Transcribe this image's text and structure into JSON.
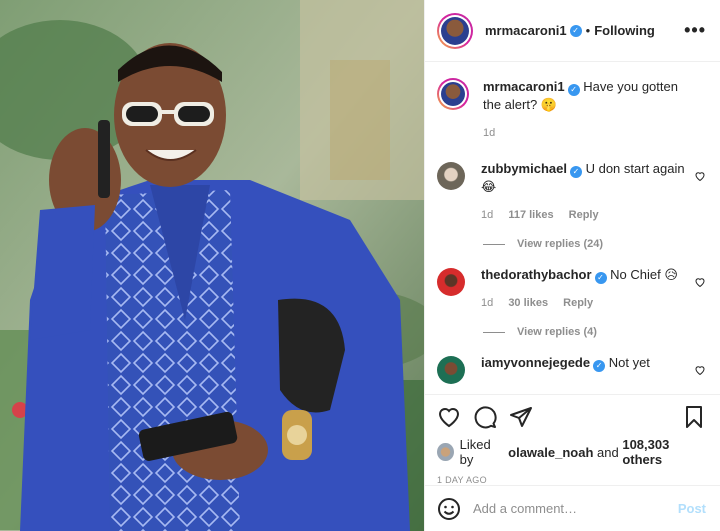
{
  "header": {
    "username": "mrmacaroni1",
    "separator": "•",
    "follow_status": "Following",
    "more_label": "•••"
  },
  "caption": {
    "username": "mrmacaroni1",
    "text": "Have you gotten the alert? 🤫",
    "time": "1d"
  },
  "comments": [
    {
      "username": "zubbymichael",
      "verified": true,
      "text": "U don start again 😂",
      "time": "1d",
      "likes": "117 likes",
      "reply": "Reply",
      "view_replies": "View replies (24)"
    },
    {
      "username": "thedorathybachor",
      "verified": true,
      "text": "No Chief 😥",
      "time": "1d",
      "likes": "30 likes",
      "reply": "Reply",
      "view_replies": "View replies (4)"
    },
    {
      "username": "iamyvonnejegede",
      "verified": true,
      "text": "Not yet"
    }
  ],
  "likes_line": {
    "prefix": "Liked by",
    "user": "olawale_noah",
    "conj": "and",
    "count": "108,303 others"
  },
  "post_age": "1 DAY AGO",
  "comment_box": {
    "placeholder": "Add a comment…",
    "post_label": "Post"
  },
  "icons": {
    "like": "heart-icon",
    "comment": "comment-icon",
    "share": "share-icon",
    "save": "bookmark-icon",
    "emoji": "emoji-icon",
    "verified": "verified-badge-icon",
    "more": "more-options-icon"
  },
  "colors": {
    "verified": "#3897f0",
    "post_button": "#b2dffc",
    "meta_text": "#8e8e8e"
  }
}
